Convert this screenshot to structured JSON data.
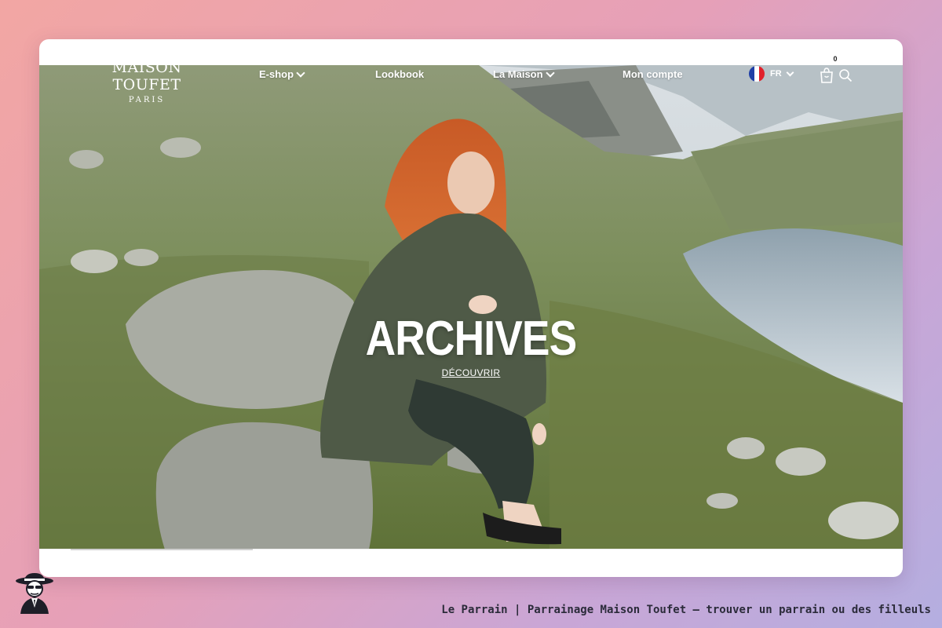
{
  "site": {
    "logo_main": "MAISON TOUFET",
    "logo_sub": "PARIS"
  },
  "nav": {
    "items": [
      {
        "label": "E-shop",
        "has_dropdown": true
      },
      {
        "label": "Lookbook",
        "has_dropdown": false
      },
      {
        "label": "La Maison",
        "has_dropdown": true
      },
      {
        "label": "Mon compte",
        "has_dropdown": false
      }
    ],
    "language": "FR",
    "cart_count": "0",
    "icons": [
      "france-flag-icon",
      "shopping-bag-icon",
      "search-icon",
      "chevron-down-icon"
    ]
  },
  "hero": {
    "title": "ARCHIVES",
    "cta": "DÉCOUVRIR",
    "slide_progress": 0.21
  },
  "footer": {
    "caption": "Le Parrain | Parrainage Maison Toufet — trouver un parrain ou des filleuls"
  },
  "colors": {
    "background_start": "#f2a6a3",
    "background_end": "#b4aee0",
    "nav_text": "#ffffff",
    "card": "#ffffff"
  }
}
